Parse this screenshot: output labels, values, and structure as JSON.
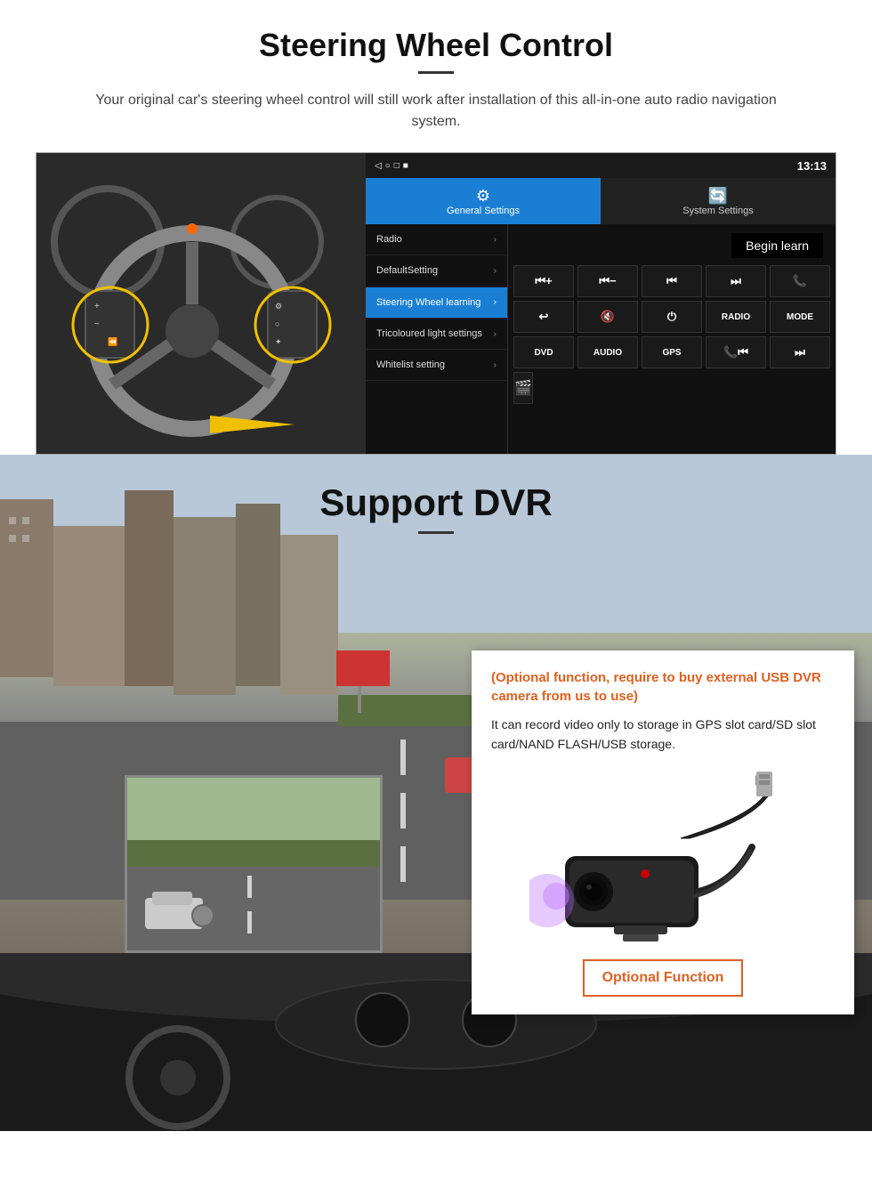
{
  "steering": {
    "title": "Steering Wheel Control",
    "subtitle": "Your original car's steering wheel control will still work after installation of this all-in-one auto radio navigation system.",
    "statusbar": {
      "icons": "◁  ○  □  ■",
      "signal": "▼",
      "time": "13:13"
    },
    "tabs": {
      "general": {
        "icon": "⚙",
        "label": "General Settings"
      },
      "system": {
        "icon": "🔄",
        "label": "System Settings"
      }
    },
    "menu": [
      {
        "label": "Radio",
        "active": false
      },
      {
        "label": "DefaultSetting",
        "active": false
      },
      {
        "label": "Steering Wheel learning",
        "active": true
      },
      {
        "label": "Tricoloured light settings",
        "active": false
      },
      {
        "label": "Whitelist setting",
        "active": false
      }
    ],
    "begin_learn": "Begin learn",
    "ctrl_buttons_row1": [
      "⏮+",
      "⏮−",
      "⏮⏮",
      "⏭⏭",
      "📞"
    ],
    "ctrl_buttons_row2": [
      "↩",
      "🔇",
      "⏻",
      "RADIO",
      "MODE"
    ],
    "ctrl_buttons_row3": [
      "DVD",
      "AUDIO",
      "GPS",
      "📞⏮",
      "⏭⏭"
    ],
    "ctrl_buttons_row4": [
      "🎬"
    ]
  },
  "dvr": {
    "title": "Support DVR",
    "card": {
      "optional_text": "(Optional function, require to buy external USB DVR camera from us to use)",
      "desc": "It can record video only to storage in GPS slot card/SD slot card/NAND FLASH/USB storage.",
      "optional_btn": "Optional Function"
    }
  }
}
